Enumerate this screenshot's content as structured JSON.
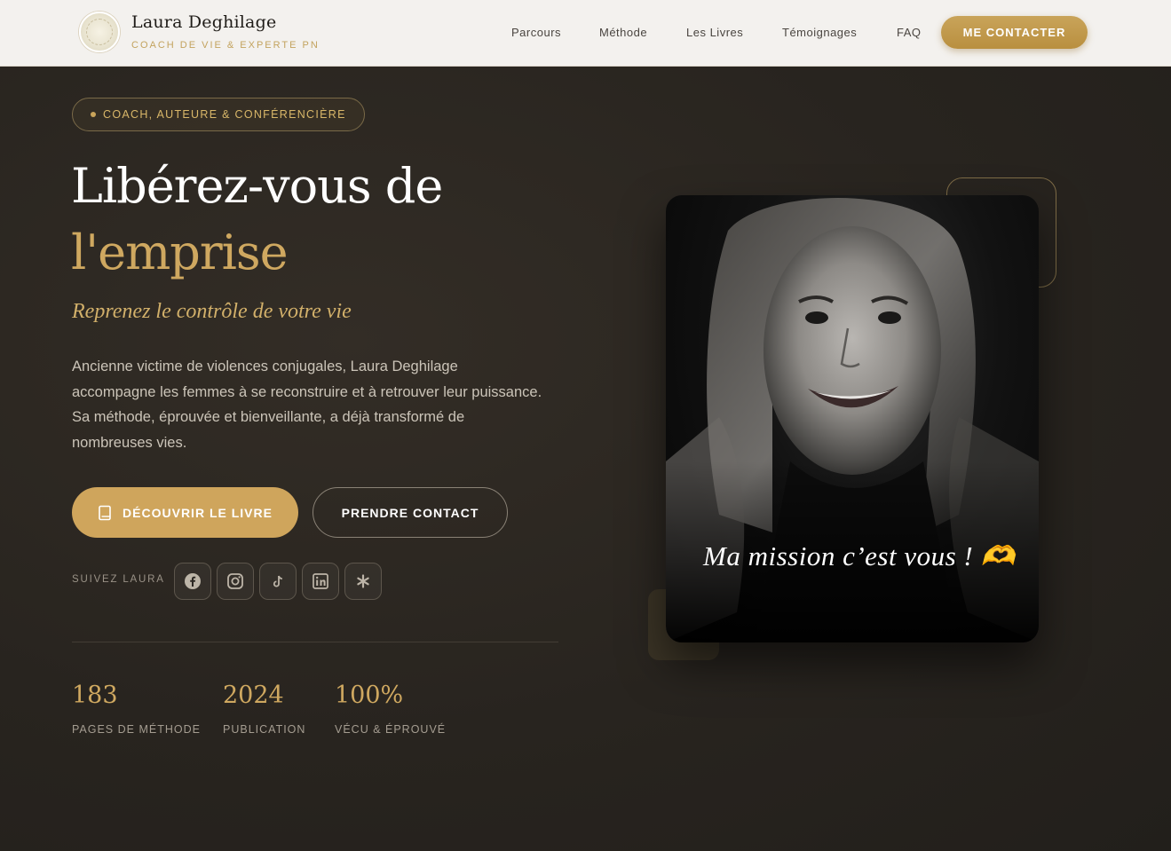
{
  "header": {
    "brand_name": "Laura Deghilage",
    "brand_sub": "COACH DE VIE & EXPERTE PN",
    "nav": [
      "Parcours",
      "Méthode",
      "Les Livres",
      "Témoignages",
      "FAQ"
    ],
    "cta": "ME CONTACTER"
  },
  "hero": {
    "tag": "COACH, AUTEURE & CONFÉRENCIÈRE",
    "title_line1": "Libérez-vous de",
    "title_line2": "l'emprise",
    "tagline": "Reprenez le contrôle de votre vie",
    "intro": "Ancienne victime de violences conjugales, Laura Deghilage accompagne les femmes à se reconstruire et à retrouver leur puissance. Sa méthode, éprouvée et bienveillante, a déjà transformé de nombreuses vies.",
    "btn_primary": "DÉCOUVRIR LE LIVRE",
    "btn_secondary": "PRENDRE CONTACT",
    "follow_label": "SUIVEZ LAURA",
    "socials": [
      "facebook-icon",
      "instagram-icon",
      "tiktok-icon",
      "linkedin-icon",
      "asterisk-icon"
    ],
    "stats": [
      {
        "value": "183",
        "label": "PAGES DE MÉTHODE"
      },
      {
        "value": "2024",
        "label": "PUBLICATION"
      },
      {
        "value": "100%",
        "label": "VÉCU & ÉPROUVÉ"
      }
    ],
    "photo_caption": "Ma mission c’est vous ! 🫶"
  },
  "colors": {
    "accent": "#cfa55c",
    "background": "#28241f",
    "header_bg": "#f3f1ee"
  }
}
